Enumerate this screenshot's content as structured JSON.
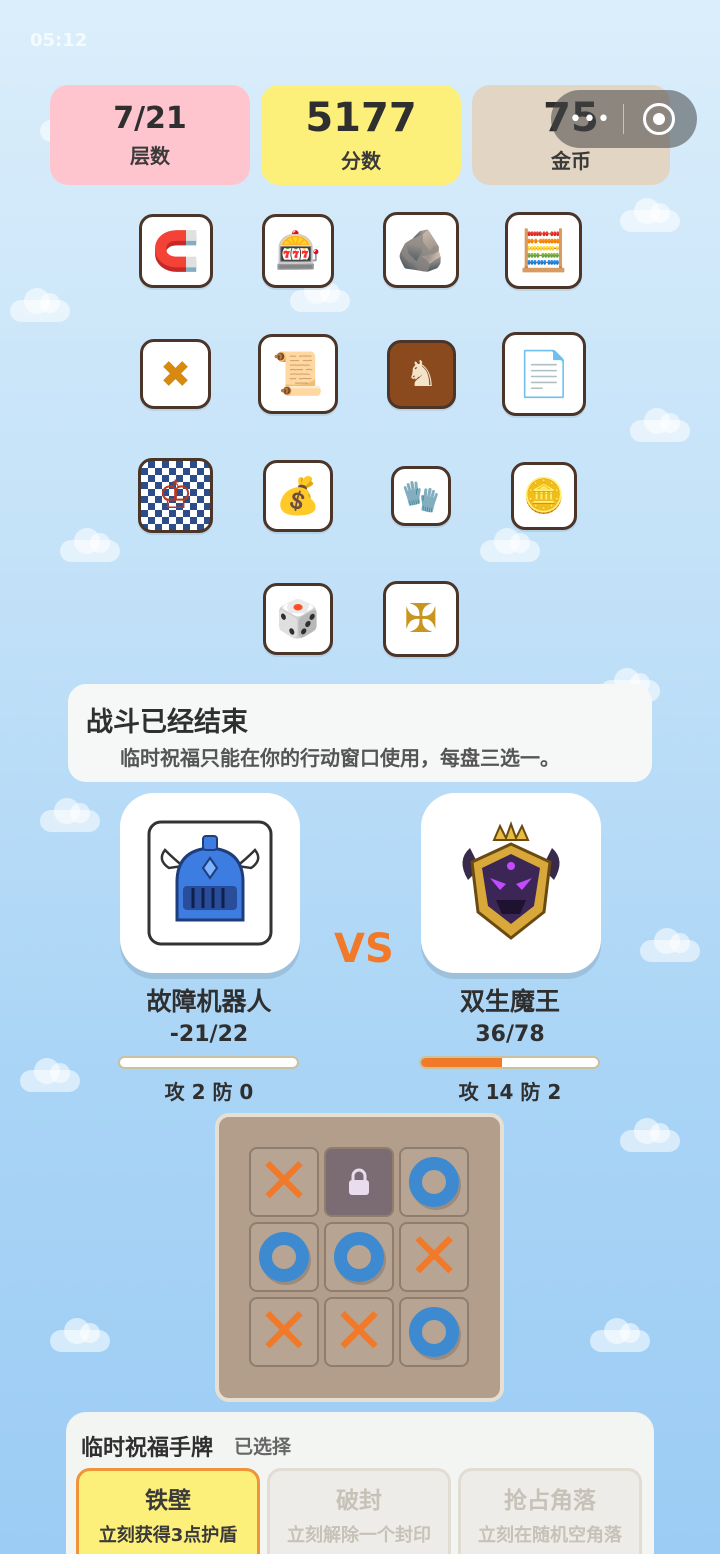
{
  "status_bar": {
    "time": "05:12",
    "right": ""
  },
  "stats": {
    "floor": {
      "value": "7/21",
      "label": "层数"
    },
    "score": {
      "value": "5177",
      "label": "分数"
    },
    "coins": {
      "value": "75",
      "label": "金币"
    }
  },
  "capsule": {
    "menu": "•••"
  },
  "items": [
    {
      "name": "magnet-icon",
      "icon": "🧲"
    },
    {
      "name": "slot-machine-icon",
      "icon": "🎰"
    },
    {
      "name": "iron-icon",
      "icon": "🪨"
    },
    {
      "name": "abacus-icon",
      "icon": "🧮"
    },
    {
      "name": "coin-x-icon",
      "icon": "✖"
    },
    {
      "name": "scroll-map-icon",
      "icon": "📜"
    },
    {
      "name": "chess-pieces-icon",
      "icon": "♞"
    },
    {
      "name": "paper-icon",
      "icon": "📄"
    },
    {
      "name": "checkerboard-icon",
      "icon": "♔"
    },
    {
      "name": "money-bag-icon",
      "icon": "💰"
    },
    {
      "name": "glove-icon",
      "icon": "🧤"
    },
    {
      "name": "gold-button-icon",
      "icon": "🪙"
    },
    {
      "name": "dice-icon",
      "icon": "🎲"
    },
    {
      "name": "gold-ornament-icon",
      "icon": "✠"
    }
  ],
  "info": {
    "title": "战斗已经结束",
    "desc": "临时祝福只能在你的行动窗口使用，每盘三选一。"
  },
  "battle": {
    "vs": "VS",
    "player": {
      "name": "故障机器人",
      "hp": "-21/22",
      "hp_fraction": 0.0,
      "stats": "攻 2  防 0"
    },
    "enemy": {
      "name": "双生魔王",
      "hp": "36/78",
      "hp_fraction": 0.46,
      "stats": "攻 14  防 2"
    }
  },
  "board": {
    "cells": [
      "X",
      "lock",
      "O",
      "O",
      "O",
      "X",
      "X",
      "X",
      "O"
    ]
  },
  "hand": {
    "title": "临时祝福手牌",
    "status": "已选择",
    "cards": [
      {
        "name": "铁壁",
        "desc": "立刻获得3点护盾",
        "selected": true
      },
      {
        "name": "破封",
        "desc": "立刻解除一个封印",
        "selected": false
      },
      {
        "name": "抢占角落",
        "desc": "立刻在随机空角落",
        "selected": false
      }
    ]
  },
  "colors": {
    "accent": "#f07a2a",
    "o_mark": "#3d8ad0",
    "floor_bg": "#ffc5ce",
    "score_bg": "#fdf07a",
    "coin_bg": "#e2d5c3"
  }
}
